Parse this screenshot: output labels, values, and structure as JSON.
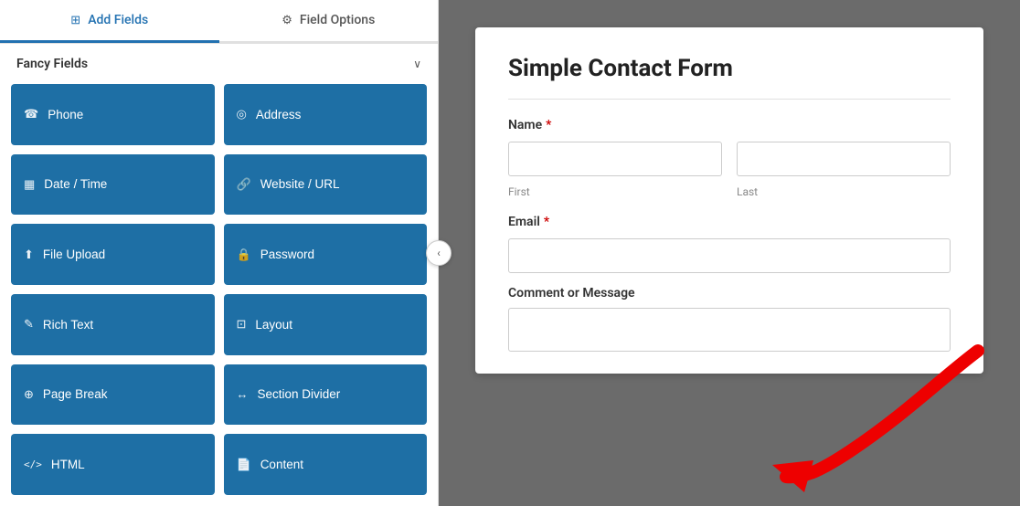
{
  "tabs": [
    {
      "id": "add-fields",
      "label": "Add Fields",
      "icon": "⊞",
      "active": true
    },
    {
      "id": "field-options",
      "label": "Field Options",
      "icon": "≡",
      "active": false
    }
  ],
  "fancy_fields": {
    "section_title": "Fancy Fields",
    "collapsed": false,
    "fields": [
      {
        "id": "phone",
        "label": "Phone",
        "icon": "☎"
      },
      {
        "id": "address",
        "label": "Address",
        "icon": "📍"
      },
      {
        "id": "date-time",
        "label": "Date / Time",
        "icon": "📅"
      },
      {
        "id": "website-url",
        "label": "Website / URL",
        "icon": "🔗"
      },
      {
        "id": "file-upload",
        "label": "File Upload",
        "icon": "⬆"
      },
      {
        "id": "password",
        "label": "Password",
        "icon": "🔒"
      },
      {
        "id": "rich-text",
        "label": "Rich Text",
        "icon": "✎"
      },
      {
        "id": "layout",
        "label": "Layout",
        "icon": "⊡"
      },
      {
        "id": "page-break",
        "label": "Page Break",
        "icon": "⊕"
      },
      {
        "id": "section-divider",
        "label": "Section Divider",
        "icon": "↔"
      },
      {
        "id": "html",
        "label": "HTML",
        "icon": "</>"
      },
      {
        "id": "content",
        "label": "Content",
        "icon": "📄"
      }
    ]
  },
  "collapse_btn_label": "‹",
  "form": {
    "title": "Simple Contact Form",
    "fields": [
      {
        "id": "name",
        "label": "Name",
        "required": true,
        "type": "name",
        "sub_fields": [
          "First",
          "Last"
        ]
      },
      {
        "id": "email",
        "label": "Email",
        "required": true,
        "type": "email"
      },
      {
        "id": "comment",
        "label": "Comment or Message",
        "required": false,
        "type": "textarea"
      }
    ]
  }
}
